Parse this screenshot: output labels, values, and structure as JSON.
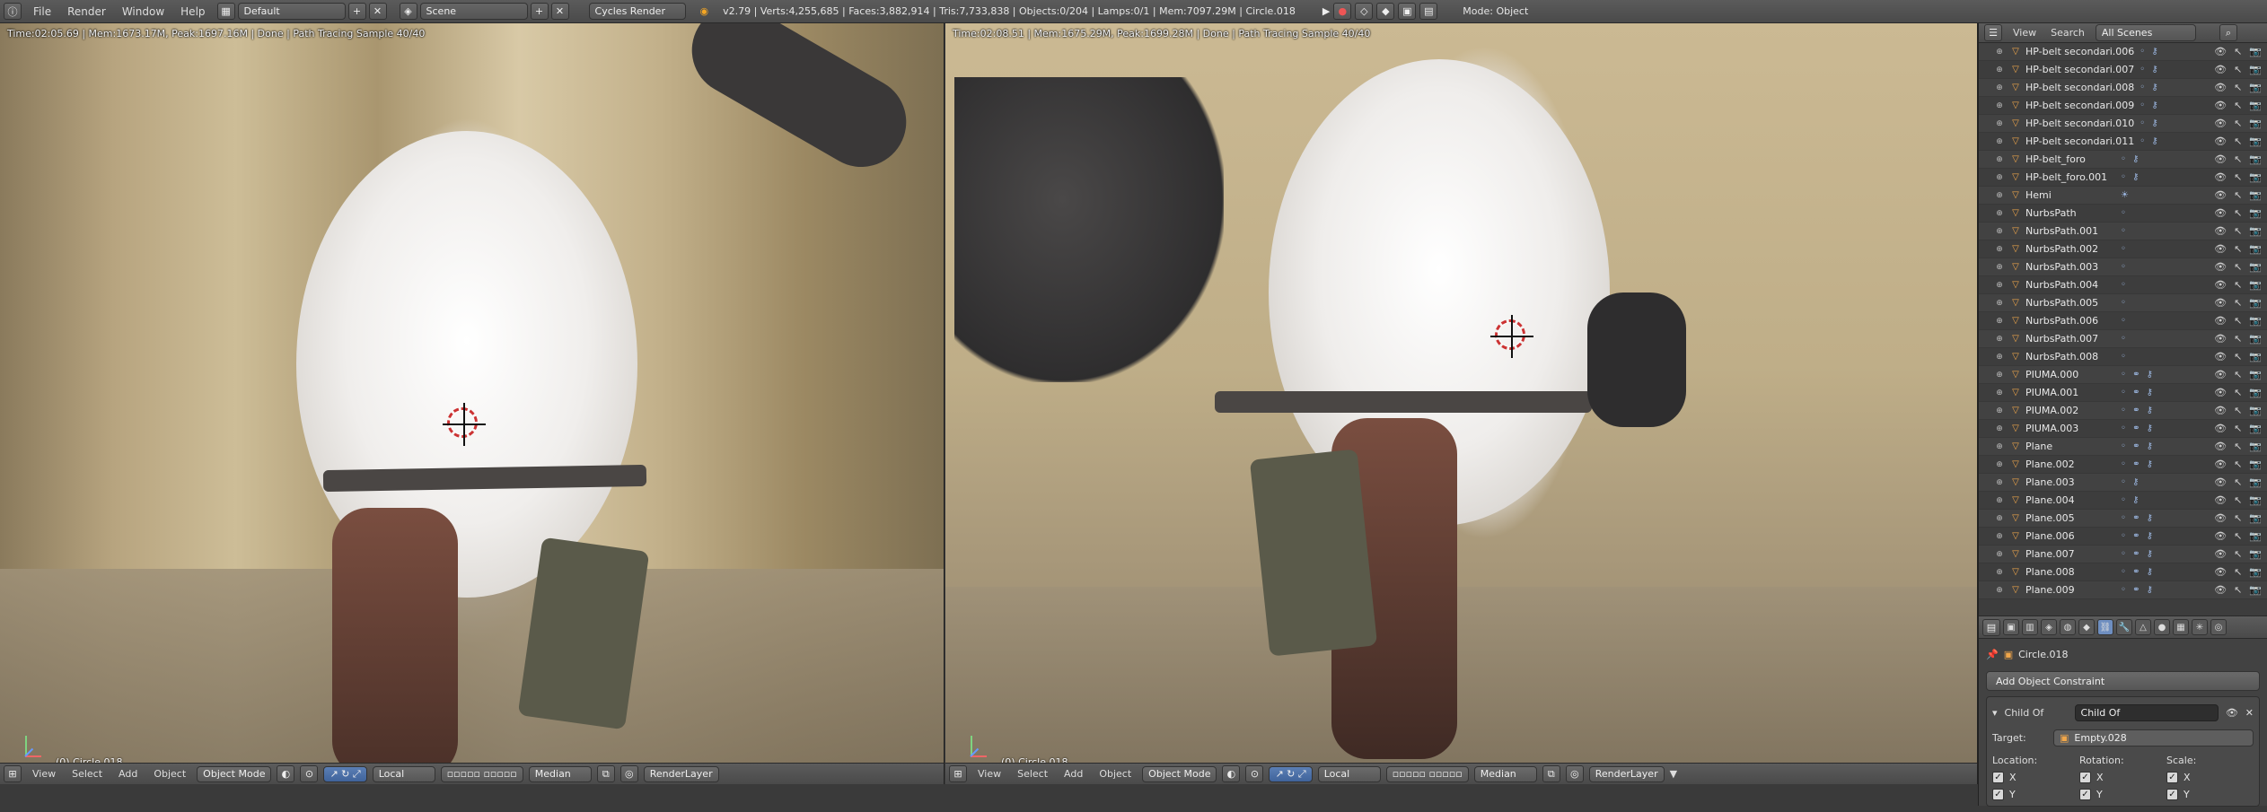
{
  "topbar": {
    "menus": [
      "File",
      "Render",
      "Window",
      "Help"
    ],
    "layout": "Default",
    "scene": "Scene",
    "engine": "Cycles Render",
    "stats": "v2.79 | Verts:4,255,685 | Faces:3,882,914 | Tris:7,733,838 | Objects:0/204 | Lamps:0/1 | Mem:7097.29M | Circle.018",
    "mode": "Mode: Object"
  },
  "viewport_left": {
    "info": "Time:02:05.69 | Mem:1673.17M, Peak:1697.16M | Done | Path Tracing Sample 40/40",
    "object": "(0) Circle.018",
    "header": {
      "menus": [
        "View",
        "Select",
        "Add",
        "Object"
      ],
      "mode": "Object Mode",
      "pivot": "Local",
      "transform": "Median",
      "layer": "RenderLayer"
    }
  },
  "viewport_right": {
    "info": "Time:02:08.51 | Mem:1675.29M, Peak:1699.28M | Done | Path Tracing Sample 40/40",
    "object": "(0) Circle.018",
    "header": {
      "menus": [
        "View",
        "Select",
        "Add",
        "Object"
      ],
      "mode": "Object Mode",
      "pivot": "Local",
      "transform": "Median",
      "layer": "RenderLayer"
    }
  },
  "outliner": {
    "header": {
      "view": "View",
      "search": "Search",
      "scope": "All Scenes"
    },
    "items": [
      {
        "name": "HP-belt secondari.006",
        "mods": "◦ ⚷"
      },
      {
        "name": "HP-belt secondari.007",
        "mods": "◦ ⚷"
      },
      {
        "name": "HP-belt secondari.008",
        "mods": "◦ ⚷"
      },
      {
        "name": "HP-belt secondari.009",
        "mods": "◦ ⚷"
      },
      {
        "name": "HP-belt secondari.010",
        "mods": "◦ ⚷"
      },
      {
        "name": "HP-belt secondari.011",
        "mods": "◦ ⚷"
      },
      {
        "name": "HP-belt_foro",
        "mods": "◦ ⚷"
      },
      {
        "name": "HP-belt_foro.001",
        "mods": "◦ ⚷"
      },
      {
        "name": "Hemi",
        "mods": "☀"
      },
      {
        "name": "NurbsPath",
        "mods": "◦"
      },
      {
        "name": "NurbsPath.001",
        "mods": "◦"
      },
      {
        "name": "NurbsPath.002",
        "mods": "◦"
      },
      {
        "name": "NurbsPath.003",
        "mods": "◦"
      },
      {
        "name": "NurbsPath.004",
        "mods": "◦"
      },
      {
        "name": "NurbsPath.005",
        "mods": "◦"
      },
      {
        "name": "NurbsPath.006",
        "mods": "◦"
      },
      {
        "name": "NurbsPath.007",
        "mods": "◦"
      },
      {
        "name": "NurbsPath.008",
        "mods": "◦"
      },
      {
        "name": "PIUMA.000",
        "mods": "◦ ⚭ ⚷"
      },
      {
        "name": "PIUMA.001",
        "mods": "◦ ⚭ ⚷"
      },
      {
        "name": "PIUMA.002",
        "mods": "◦ ⚭ ⚷"
      },
      {
        "name": "PIUMA.003",
        "mods": "◦ ⚭ ⚷"
      },
      {
        "name": "Plane",
        "mods": "◦ ⚭ ⚷"
      },
      {
        "name": "Plane.002",
        "mods": "◦ ⚭ ⚷"
      },
      {
        "name": "Plane.003",
        "mods": "◦ ⚷"
      },
      {
        "name": "Plane.004",
        "mods": "◦ ⚷"
      },
      {
        "name": "Plane.005",
        "mods": "◦ ⚭ ⚷"
      },
      {
        "name": "Plane.006",
        "mods": "◦ ⚭ ⚷"
      },
      {
        "name": "Plane.007",
        "mods": "◦ ⚭ ⚷"
      },
      {
        "name": "Plane.008",
        "mods": "◦ ⚭ ⚷"
      },
      {
        "name": "Plane.009",
        "mods": "◦ ⚭ ⚷"
      }
    ]
  },
  "properties": {
    "breadcrumb": "Circle.018",
    "add_constraint": "Add Object Constraint",
    "constraint": {
      "type": "Child Of",
      "name": "Child Of",
      "target_label": "Target:",
      "target": "Empty.028",
      "location_label": "Location:",
      "rotation_label": "Rotation:",
      "scale_label": "Scale:",
      "x": "X",
      "y": "Y"
    }
  },
  "colors": {
    "accent": "#5b7fb5",
    "object_icon": "#f0a64a"
  }
}
